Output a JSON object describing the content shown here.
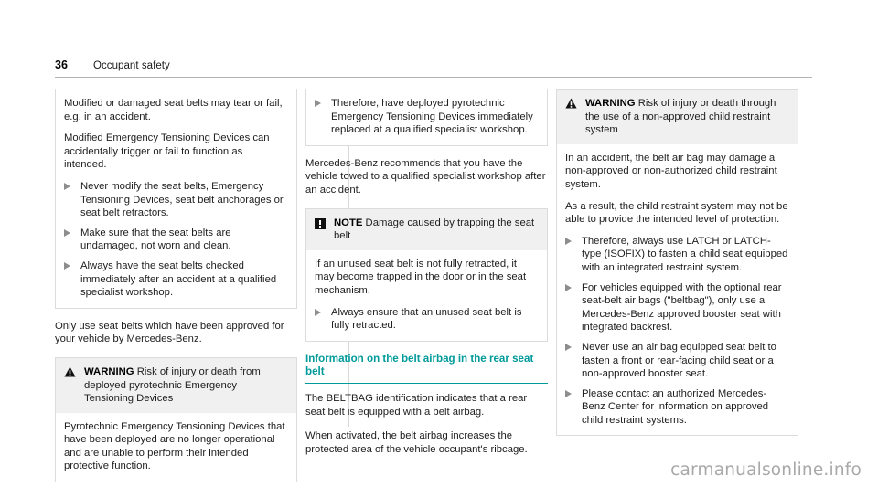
{
  "header": {
    "page_number": "36",
    "title": "Occupant safety"
  },
  "watermark": "carmanualsonline.info",
  "colors": {
    "accent_teal": "#009a9a",
    "hazard_head_bg": "#f0f0f0",
    "bullet_marker": "#8d8d8d",
    "rule": "#d9d9d9"
  },
  "columns": {
    "col1": {
      "continued_hazard": {
        "icon": "warning-triangle-icon",
        "paragraphs": [
          "Modified or damaged seat belts may tear or fail, e.g. in an accident.",
          "Modified Emergency Tensioning Devices can accidentally trigger or fail to function as intended."
        ],
        "bullets": [
          "Never modify the seat belts, Emergency Tensioning Devices, seat belt anchorages or seat belt retractors.",
          "Make sure that the seat belts are undamaged, not worn and clean.",
          "Always have the seat belts checked immediately after an accident at a qualified specialist workshop."
        ]
      },
      "body_paragraph": "Only use seat belts which have been approved for your vehicle by Mercedes-Benz.",
      "warning_box": {
        "icon": "warning-triangle-icon",
        "kind": "WARNING",
        "headline": " Risk of injury or death from deployed pyrotechnic Emergency Tensioning Devices",
        "paragraphs": [
          "Pyrotechnic Emergency Tensioning Devices that have been deployed are no longer operational and are unable to perform their intended protective function."
        ]
      }
    },
    "col2": {
      "continued_hazard": {
        "bullets": [
          "Therefore, have deployed pyrotechnic Emergency Tensioning Devices immediately replaced at a qualified specialist workshop."
        ]
      },
      "body_paragraph": "Mercedes-Benz recommends that you have the vehicle towed to a qualified specialist workshop after an accident.",
      "note_box": {
        "icon": "note-exclamation-icon",
        "kind": "NOTE",
        "headline": " Damage caused by trapping the seat belt",
        "paragraphs": [
          "If an unused seat belt is not fully retracted, it may become trapped in the door or in the seat mechanism."
        ],
        "bullets": [
          "Always ensure that an unused seat belt is fully retracted."
        ]
      },
      "section": {
        "heading": "Information on the belt airbag in the rear seat belt",
        "paragraphs": [
          "The BELTBAG identification indicates that a rear seat belt is equipped with a belt airbag.",
          "When activated, the belt airbag increases the protected area of the vehicle occupant's ribcage."
        ]
      }
    },
    "col3": {
      "warning_box": {
        "icon": "warning-triangle-icon",
        "kind": "WARNING",
        "headline": " Risk of injury or death through the use of a non-approved child restraint system",
        "paragraphs": [
          "In an accident, the belt air bag may damage a non-approved or non-authorized child restraint system.",
          "As a result, the child restraint system may not be able to provide the intended level of protection."
        ],
        "bullets": [
          "Therefore, always use LATCH or LATCH-type (ISOFIX) to fasten a child seat equipped with an integrated restraint system.",
          "For vehicles equipped with the optional rear seat-belt air bags (\"beltbag\"), only use a Mercedes-Benz approved booster seat with integrated backrest.",
          "Never use an air bag equipped seat belt to fasten a front or rear-facing child seat or a non-approved booster seat.",
          "Please contact an authorized Mercedes-Benz Center for information on approved child restraint systems."
        ]
      }
    }
  }
}
